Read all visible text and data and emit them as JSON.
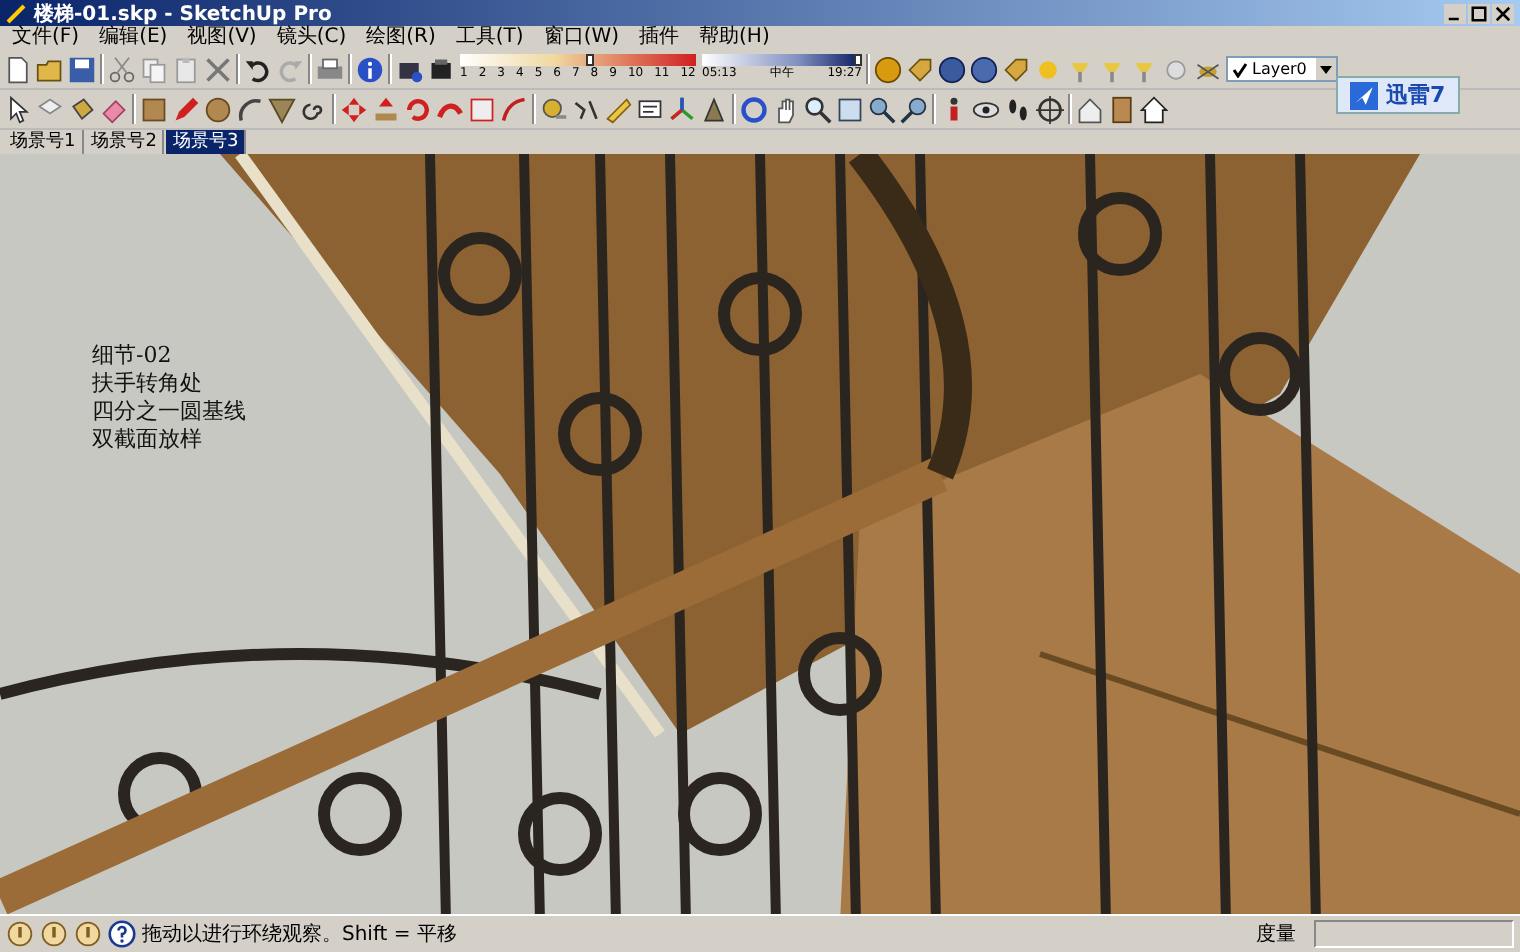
{
  "window": {
    "title": "楼梯-01.skp - SketchUp Pro"
  },
  "menu": [
    "文件(F)",
    "编辑(E)",
    "视图(V)",
    "镜头(C)",
    "绘图(R)",
    "工具(T)",
    "窗口(W)",
    "插件",
    "帮助(H)"
  ],
  "shadow_settings": {
    "months": {
      "ticks": [
        "1",
        "2",
        "3",
        "4",
        "5",
        "6",
        "7",
        "8",
        "9",
        "10",
        "11",
        "12"
      ],
      "level": 0.55
    },
    "time": {
      "start": "05:13",
      "middle": "中午",
      "end": "19:27",
      "level": 0.97
    }
  },
  "layer_selector": {
    "value": "Layer0"
  },
  "notification": {
    "text": "迅雷7"
  },
  "scene_tabs": [
    {
      "label": "场景号1",
      "selected": false
    },
    {
      "label": "场景号2",
      "selected": false
    },
    {
      "label": "场景号3",
      "selected": true
    }
  ],
  "viewport": {
    "annotation": [
      "细节-02",
      "扶手转角处",
      "四分之一圆基线",
      "双截面放样"
    ]
  },
  "status_bar": {
    "message": "拖动以进行环绕观察。Shift = 平移",
    "measurement_label": "度量"
  }
}
